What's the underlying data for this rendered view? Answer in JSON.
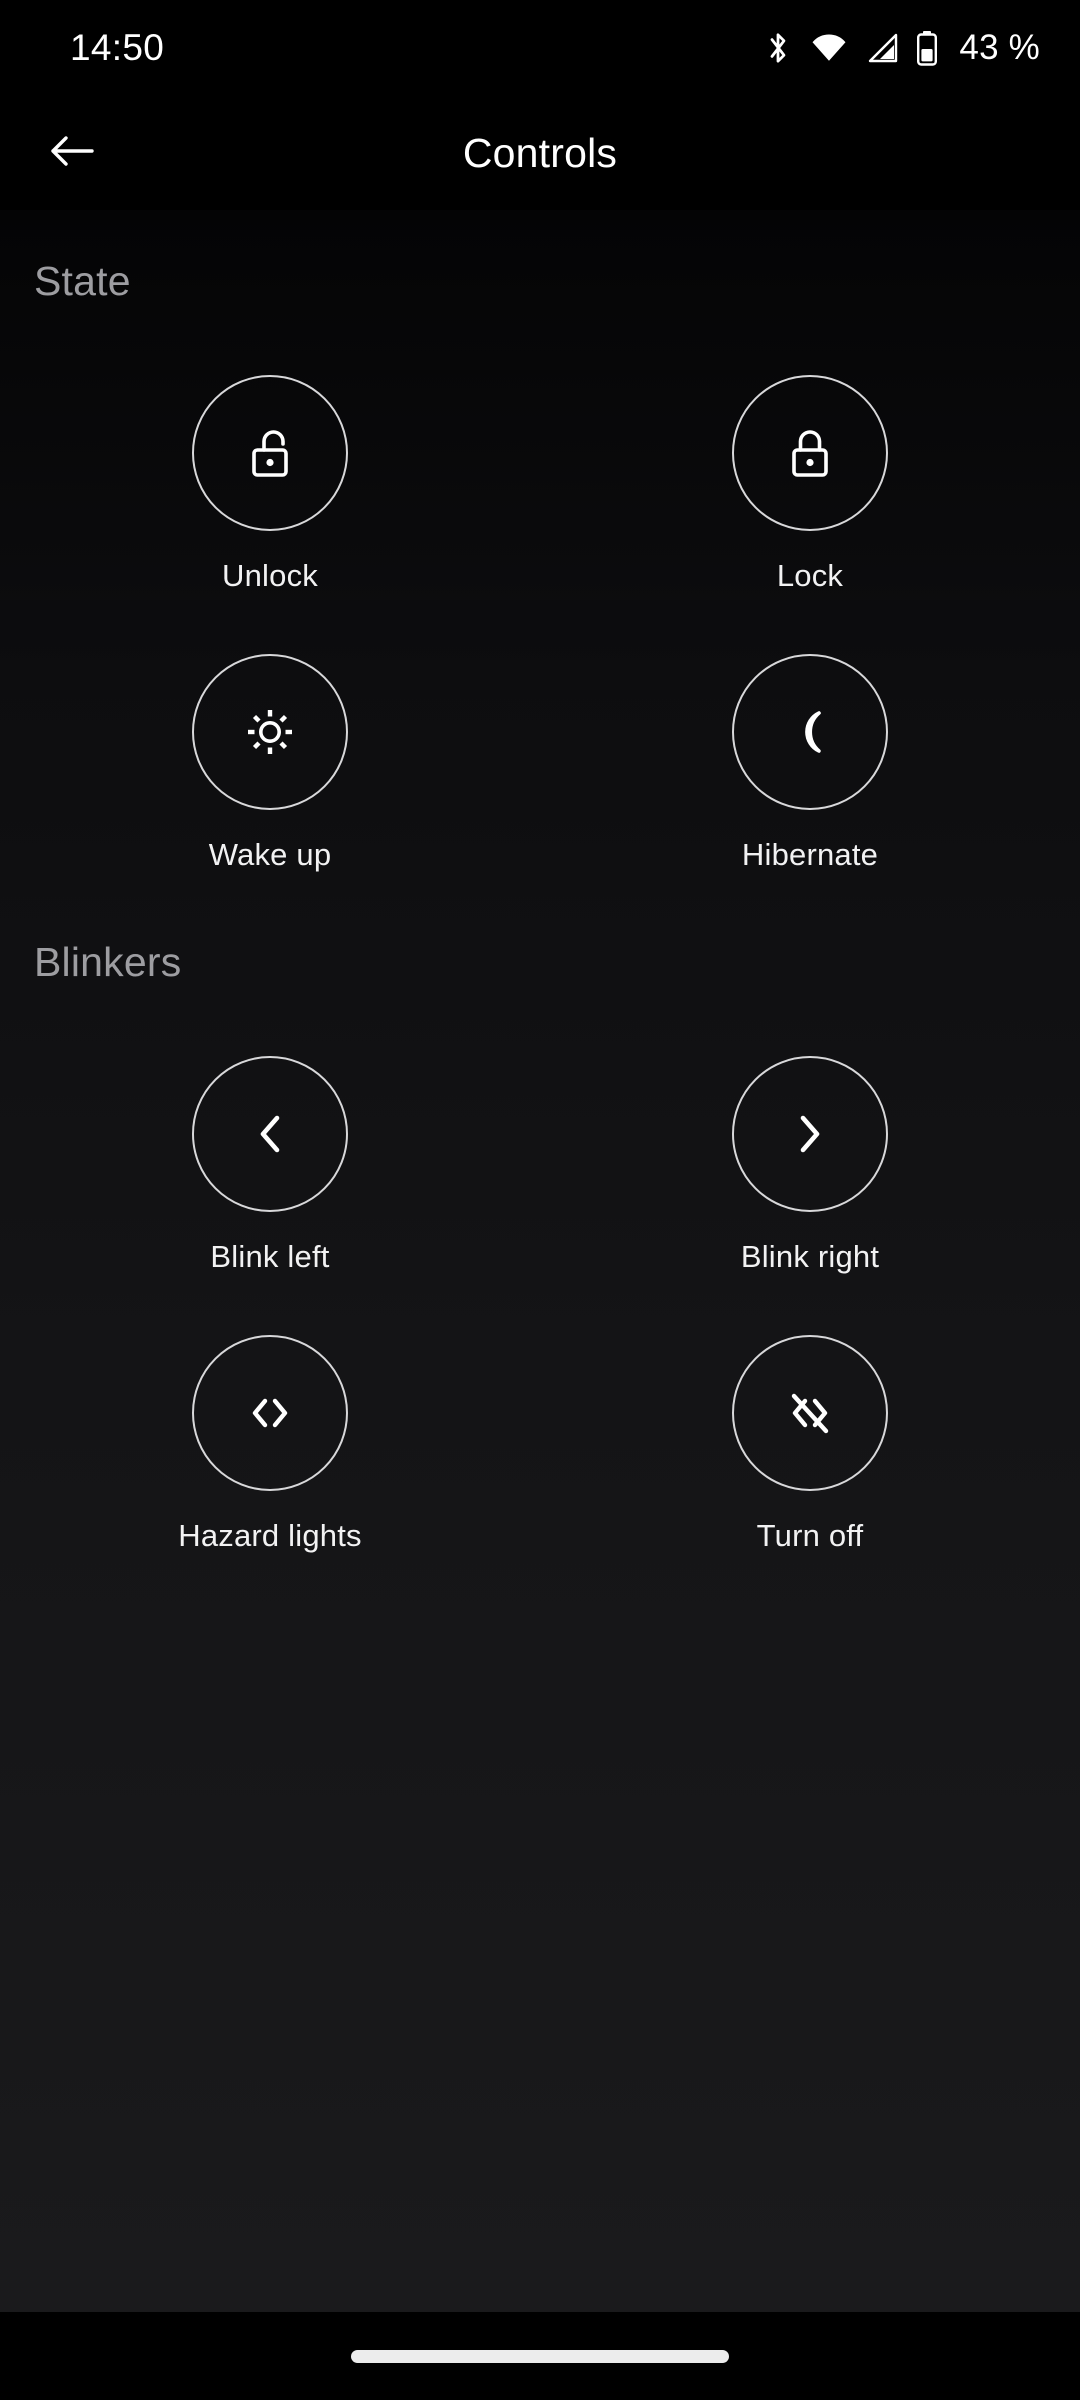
{
  "status_bar": {
    "time": "14:50",
    "battery_percent": "43 %",
    "icons": [
      "bluetooth-icon",
      "wifi-icon",
      "cellular-signal-icon",
      "battery-icon"
    ]
  },
  "app_bar": {
    "back_label": "back-arrow-icon",
    "title": "Controls"
  },
  "sections": [
    {
      "title": "State",
      "items": [
        {
          "label": "Unlock",
          "icon": "padlock-open-icon"
        },
        {
          "label": "Lock",
          "icon": "padlock-closed-icon"
        },
        {
          "label": "Wake up",
          "icon": "sun-icon"
        },
        {
          "label": "Hibernate",
          "icon": "crescent-moon-icon"
        }
      ]
    },
    {
      "title": "Blinkers",
      "items": [
        {
          "label": "Blink left",
          "icon": "chevron-left-icon"
        },
        {
          "label": "Blink right",
          "icon": "chevron-right-icon"
        },
        {
          "label": "Hazard lights",
          "icon": "double-chevron-outward-icon"
        },
        {
          "label": "Turn off",
          "icon": "double-chevron-outward-slash-icon"
        }
      ]
    }
  ],
  "nav_bar": {
    "handle": "gesture-home-handle"
  },
  "colors": {
    "background": "#000000",
    "content_background": "#141416",
    "primary_text": "#ffffff",
    "secondary_text": "#9d9da1",
    "icon_stroke": "#ffffff",
    "circle_border": "#d8d8da"
  }
}
